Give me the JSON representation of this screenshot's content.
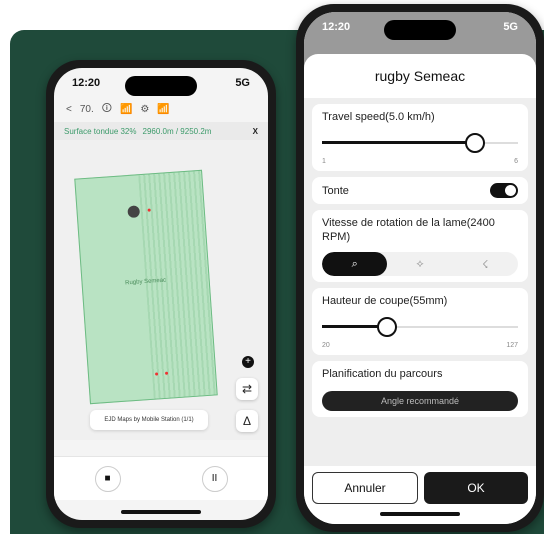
{
  "left_phone": {
    "status": {
      "time": "12:20",
      "signal": "5G"
    },
    "toolbar": {
      "back": "<",
      "battery": "70.",
      "icons": [
        "🛈",
        "📶",
        "⚙",
        "📶"
      ]
    },
    "info_strip": {
      "surface": "Surface tondue 32%",
      "area": "2960.0m / 9250.2m",
      "close": "X"
    },
    "map": {
      "field_label": "Rugby Semeac",
      "map_source_label": "EJD Maps by Mobile Station (1/1)"
    },
    "side_buttons": {
      "plus": "+",
      "settings": "⇄",
      "navigate": "Δ"
    },
    "controls": {
      "stop": "■",
      "pause": "II"
    }
  },
  "right_phone": {
    "status": {
      "time": "12:20",
      "signal": "5G"
    },
    "sheet": {
      "title": "rugby Semeac",
      "travel_speed": {
        "label": "Travel speed(5.0 km/h)",
        "value": 5.0,
        "min": "1",
        "max": "6"
      },
      "mowing": {
        "label": "Tonte",
        "on": true
      },
      "blade_speed": {
        "label": "Vitesse de rotation de la lame(2400 RPM)",
        "options": [
          "⌕",
          "⟡",
          "☇"
        ],
        "selected_index": 0
      },
      "cut_height": {
        "label": "Hauteur de coupe(55mm)",
        "value": 55,
        "min": "20",
        "max": "127"
      },
      "planning": {
        "label": "Planification du parcours",
        "button": "Angle recommandé"
      }
    },
    "footer": {
      "cancel": "Annuler",
      "ok": "OK"
    }
  }
}
